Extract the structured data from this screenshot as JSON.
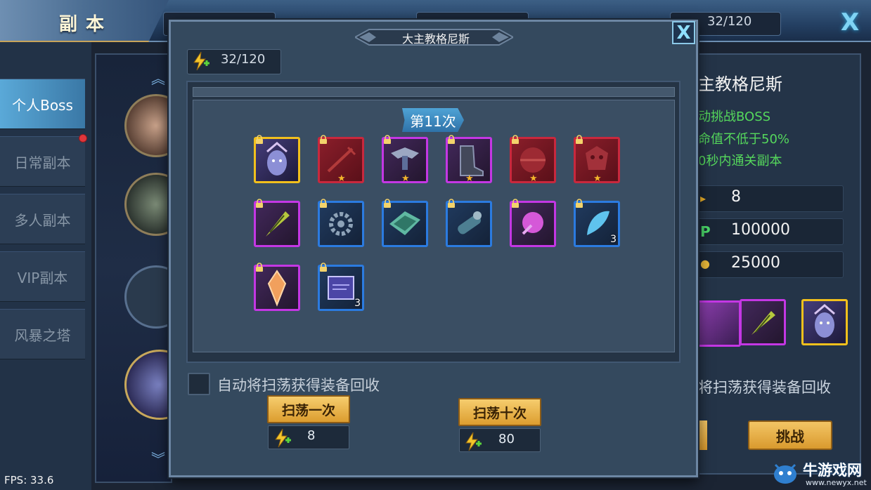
{
  "header": {
    "title": "副本",
    "energy": "32/120",
    "close_glyph": "X"
  },
  "tabs": [
    {
      "label": "个人Boss",
      "active": true
    },
    {
      "label": "日常副本",
      "active": false,
      "has_badge": true
    },
    {
      "label": "多人副本",
      "active": false
    },
    {
      "label": "VIP副本",
      "active": false
    },
    {
      "label": "风暴之塔",
      "active": false
    }
  ],
  "background_detail": {
    "boss_name_fragment": "主教格尼斯",
    "requirements": [
      "动挑战BOSS",
      "命值不低于50%",
      "0秒内通关副本"
    ],
    "stats": [
      {
        "icon": "energy-icon",
        "value": "8"
      },
      {
        "icon": "exp-icon",
        "icon_text": "P",
        "value": "100000"
      },
      {
        "icon": "coin-icon",
        "value": "25000"
      }
    ],
    "recycle_fragment": "将扫荡获得装备回收",
    "challenge_label": "挑战"
  },
  "modal": {
    "title": "大主教格尼斯",
    "close_glyph": "X",
    "energy": "32/120",
    "round_label": "第11次",
    "items": [
      {
        "name": "boss-portrait-item",
        "rarity": "gold",
        "locked": true,
        "star": false,
        "count": ""
      },
      {
        "name": "weapon-item",
        "rarity": "red",
        "locked": true,
        "star": true,
        "count": ""
      },
      {
        "name": "armor-item",
        "rarity": "purple",
        "locked": true,
        "star": true,
        "count": ""
      },
      {
        "name": "boots-item",
        "rarity": "purple",
        "locked": true,
        "star": true,
        "count": ""
      },
      {
        "name": "helmet-item",
        "rarity": "red",
        "locked": true,
        "star": true,
        "count": ""
      },
      {
        "name": "mask-item",
        "rarity": "red",
        "locked": true,
        "star": true,
        "count": ""
      },
      {
        "name": "leaf-item",
        "rarity": "purple",
        "locked": true,
        "star": false,
        "count": ""
      },
      {
        "name": "gear-item",
        "rarity": "blue",
        "locked": true,
        "star": false,
        "count": ""
      },
      {
        "name": "plate-item",
        "rarity": "blue",
        "locked": true,
        "star": false,
        "count": ""
      },
      {
        "name": "scroll-item",
        "rarity": "blue",
        "locked": true,
        "star": false,
        "count": ""
      },
      {
        "name": "orb-item",
        "rarity": "purple",
        "locked": true,
        "star": false,
        "count": ""
      },
      {
        "name": "feather-item",
        "rarity": "blue",
        "locked": true,
        "star": false,
        "count": "3"
      },
      {
        "name": "crystal-item",
        "rarity": "purple",
        "locked": true,
        "star": false,
        "count": ""
      },
      {
        "name": "book-item",
        "rarity": "blue",
        "locked": true,
        "star": false,
        "count": "3"
      }
    ],
    "auto_recycle_label": "自动将扫荡获得装备回收",
    "sweep_once": {
      "label": "扫荡一次",
      "cost": "8"
    },
    "sweep_ten": {
      "label": "扫荡十次",
      "cost": "80"
    }
  },
  "fps": "FPS: 33.6",
  "watermark": {
    "text": "牛游戏网",
    "url": "www.newyx.net"
  },
  "colors": {
    "accent": "#5aa9d8",
    "gold_button": "#f6cd6e",
    "requirement_green": "#55d85c",
    "rarity_gold": "#f2c01c",
    "rarity_red": "#c9283d",
    "rarity_purple": "#c437e4",
    "rarity_blue": "#2b7be0"
  }
}
